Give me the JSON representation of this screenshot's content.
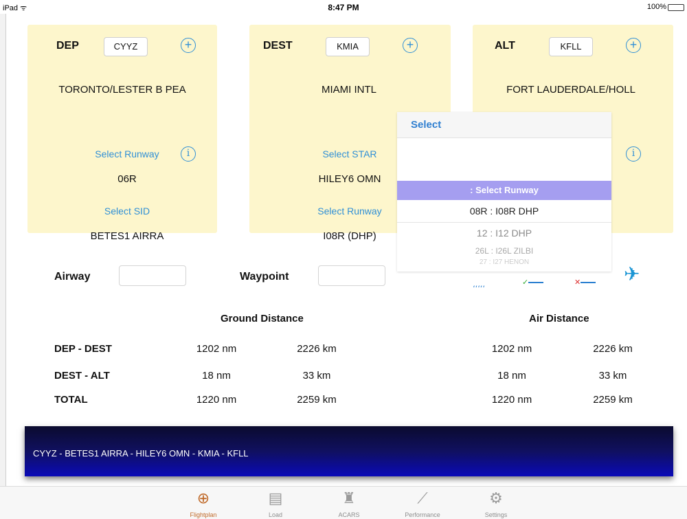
{
  "statusbar": {
    "device": "iPad ᯤ",
    "time": "8:47 PM",
    "battery": "100%"
  },
  "dep": {
    "label": "DEP",
    "code": "CYYZ",
    "name": "TORONTO/LESTER B PEA",
    "link1": "Select Runway",
    "value1": "06R",
    "link2": "Select SID",
    "value2": "BETES1 AIRRA"
  },
  "dest": {
    "label": "DEST",
    "code": "KMIA",
    "name": "MIAMI INTL",
    "link1": "Select STAR",
    "value1": "HILEY6 OMN",
    "link2": "Select Runway",
    "value2": "I08R (DHP)"
  },
  "alt": {
    "label": "ALT",
    "code": "KFLL",
    "name": "FORT LAUDERDALE/HOLL"
  },
  "picker": {
    "title": "Select",
    "selected": ": Select Runway",
    "options": [
      "08R : I08R DHP",
      "12 : I12 DHP",
      "26L : I26L ZILBI",
      "27 : I27 HENON"
    ]
  },
  "airway": {
    "label": "Airway",
    "value": ""
  },
  "waypoint": {
    "label": "Waypoint",
    "value": ""
  },
  "distance": {
    "ground_header": "Ground Distance",
    "air_header": "Air Distance",
    "rows": [
      {
        "label": "DEP - DEST",
        "g_nm": "1202 nm",
        "g_km": "2226 km",
        "a_nm": "1202 nm",
        "a_km": "2226 km"
      },
      {
        "label": "DEST - ALT",
        "g_nm": "18 nm",
        "g_km": "33 km",
        "a_nm": "18 nm",
        "a_km": "33 km"
      },
      {
        "label": "TOTAL",
        "g_nm": "1220 nm",
        "g_km": "2259 km",
        "a_nm": "1220 nm",
        "a_km": "2259 km"
      }
    ]
  },
  "route": {
    "text": "CYYZ - BETES1 AIRRA - HILEY6 OMN - KMIA - KFLL"
  },
  "tabs": [
    {
      "label": "Flightplan",
      "icon": "globe-icon"
    },
    {
      "label": "Load",
      "icon": "load-icon"
    },
    {
      "label": "ACARS",
      "icon": "tower-icon"
    },
    {
      "label": "Performance",
      "icon": "chart-icon"
    },
    {
      "label": "Settings",
      "icon": "gear-icon"
    }
  ],
  "colors": {
    "card_bg": "#fdf6cc",
    "link": "#2f8fd6",
    "picker_sel": "#a59ef0",
    "active_tab": "#c06a2a"
  }
}
